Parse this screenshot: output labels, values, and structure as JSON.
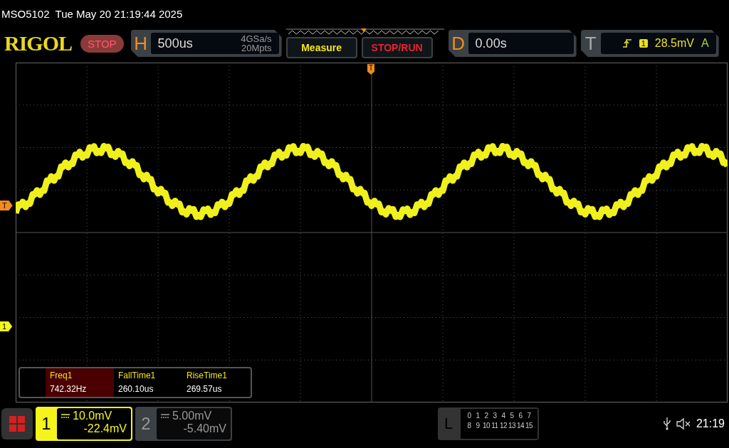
{
  "title_bar": {
    "model": "MSO5102",
    "datetime": "Tue May 20 21:19:44 2025"
  },
  "toolbar": {
    "logo": "RIGOL",
    "run_state": "STOP",
    "horizontal": {
      "label": "H",
      "timebase": "500us",
      "sample_rate": "4GSa/s",
      "memory_depth": "20Mpts"
    },
    "buttons": [
      {
        "label": "Measure",
        "kind": "measure"
      },
      {
        "label": "STOP/RUN",
        "kind": "stoprun"
      }
    ],
    "delay": {
      "label": "D",
      "value": "0.00s"
    },
    "trigger": {
      "label": "T",
      "source": "1",
      "level": "28.5mV",
      "mode": "A"
    }
  },
  "grid": {
    "trigger_position_marker": "T",
    "trigger_level_marker": "T",
    "channel_marker": "1"
  },
  "measurements": [
    {
      "name": "Freq1",
      "value": "742.32Hz",
      "selected": true
    },
    {
      "name": "FallTime1",
      "value": "260.10us",
      "selected": false
    },
    {
      "name": "RiseTime1",
      "value": "269.57us",
      "selected": false
    }
  ],
  "channels": [
    {
      "number": "1",
      "scale": "10.0mV",
      "offset": "-22.4mV",
      "selected": true
    },
    {
      "number": "2",
      "scale": "5.00mV",
      "offset": "-5.40mV",
      "selected": false
    }
  ],
  "logic": {
    "label": "L",
    "rows": [
      [
        "0",
        "1",
        "2",
        "3",
        "4",
        "5",
        "6",
        "7"
      ],
      [
        "8",
        "9",
        "10",
        "11",
        "12",
        "13",
        "14",
        "15"
      ]
    ]
  },
  "clock": "21:19"
}
